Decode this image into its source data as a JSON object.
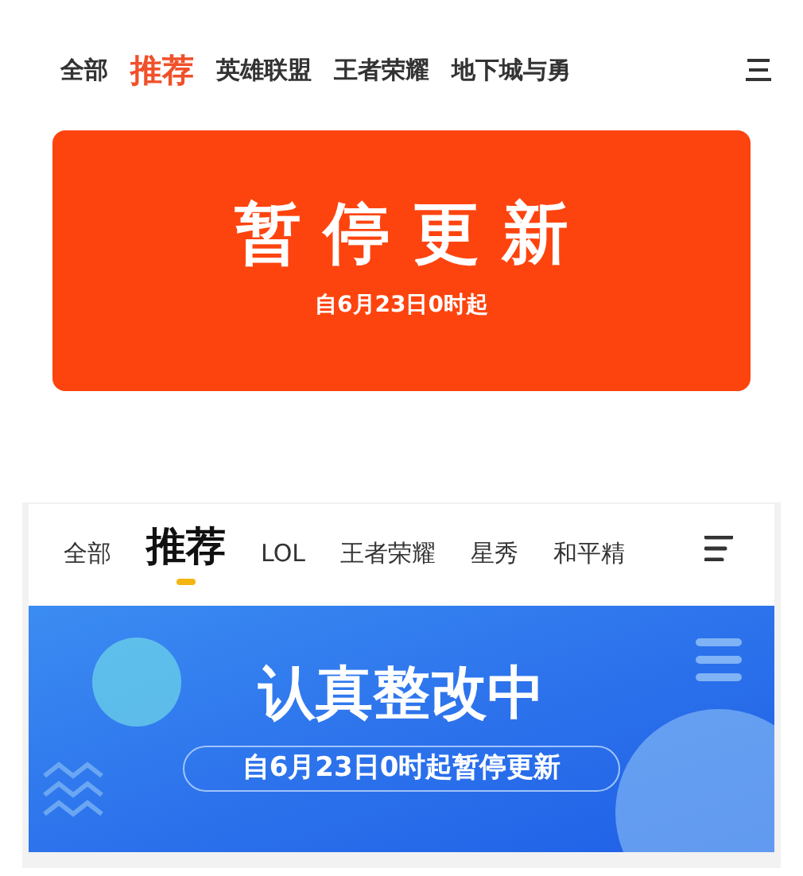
{
  "top_app": {
    "tabs": [
      {
        "label": "全部",
        "selected": false
      },
      {
        "label": "推荐",
        "selected": true
      },
      {
        "label": "英雄联盟",
        "selected": false
      },
      {
        "label": "王者荣耀",
        "selected": false
      },
      {
        "label": "地下城与勇",
        "selected": false
      }
    ],
    "banner": {
      "title": "暂停更新",
      "subtitle": "自6月23日0时起"
    }
  },
  "bottom_app": {
    "tabs": [
      {
        "label": "全部",
        "selected": false
      },
      {
        "label": "推荐",
        "selected": true
      },
      {
        "label": "LOL",
        "selected": false
      },
      {
        "label": "王者荣耀",
        "selected": false
      },
      {
        "label": "星秀",
        "selected": false
      },
      {
        "label": "和平精",
        "selected": false
      }
    ],
    "banner": {
      "title": "认真整改中",
      "subtitle": "自6月23日0时起暂停更新"
    }
  }
}
